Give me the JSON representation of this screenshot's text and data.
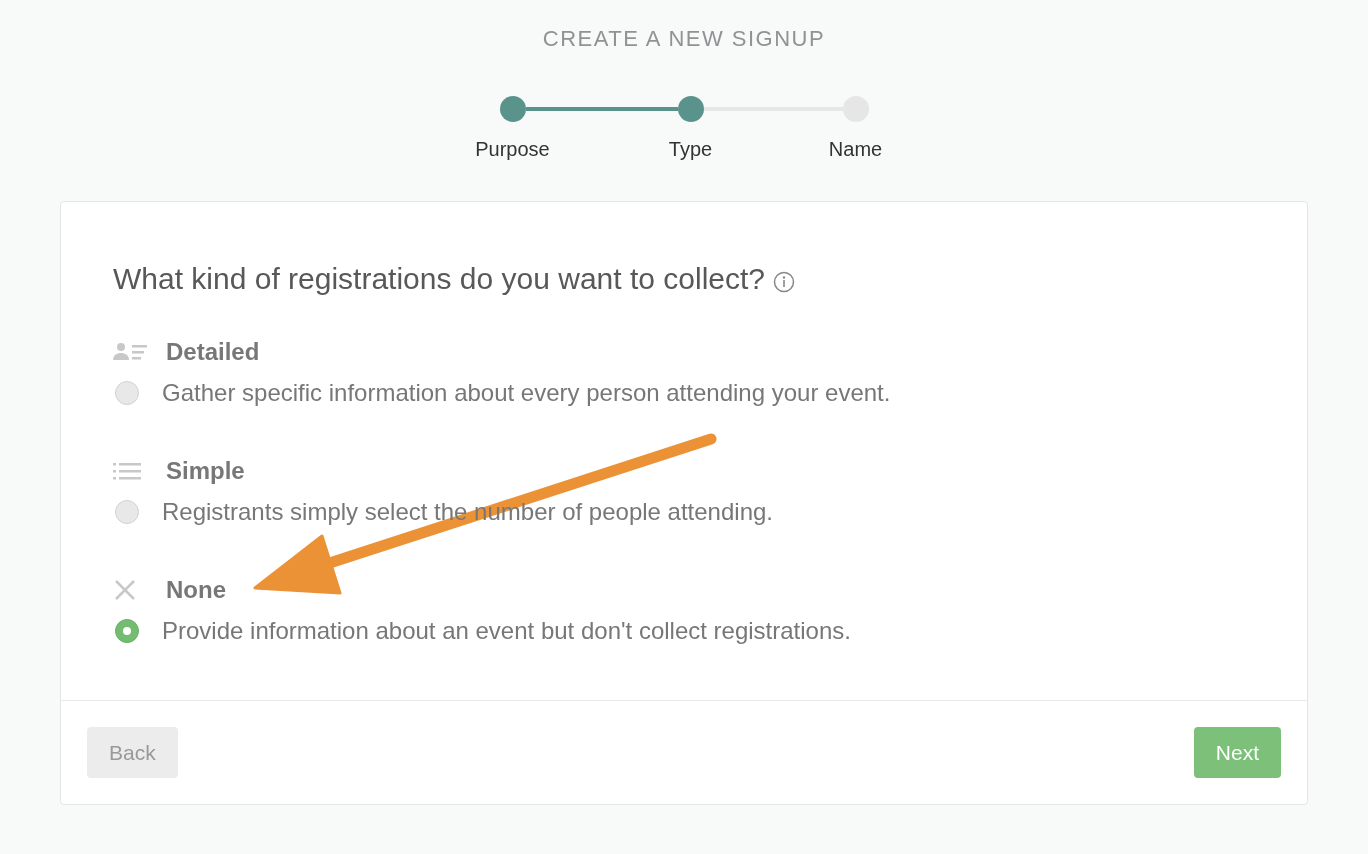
{
  "title": "CREATE A NEW SIGNUP",
  "steps": [
    {
      "label": "Purpose",
      "completed": true
    },
    {
      "label": "Type",
      "completed": true
    },
    {
      "label": "Name",
      "completed": false
    }
  ],
  "question": "What kind of registrations do you want to collect?",
  "options": [
    {
      "kind": "detailed",
      "label": "Detailed",
      "description": "Gather specific information about every person attending your event.",
      "selected": false
    },
    {
      "kind": "simple",
      "label": "Simple",
      "description": "Registrants simply select the number of people attending.",
      "selected": false
    },
    {
      "kind": "none",
      "label": "None",
      "description": "Provide information about an event but don't collect registrations.",
      "selected": true
    }
  ],
  "buttons": {
    "back": "Back",
    "next": "Next"
  }
}
